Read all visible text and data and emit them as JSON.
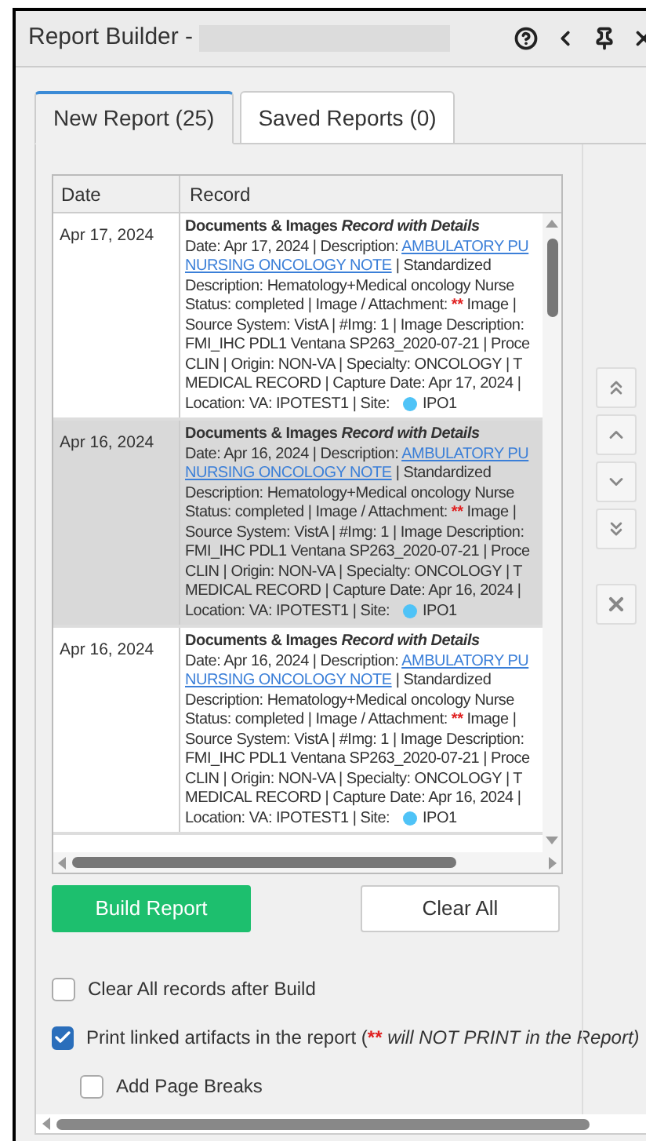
{
  "window": {
    "title": "Report Builder -"
  },
  "tabs": [
    {
      "label": "New Report (25)",
      "selected": true
    },
    {
      "label": "Saved Reports (0)",
      "selected": false
    }
  ],
  "table": {
    "columns": [
      "Date",
      "Record"
    ],
    "rows": [
      {
        "date": "Apr 17, 2024",
        "selected": false,
        "title": "Documents & Images *Record with Details*",
        "lines": [
          [
            {
              "kind": "text",
              "text": "Date: Apr 17, 2024 | Description: "
            },
            {
              "kind": "link",
              "text": "AMBULATORY PU"
            }
          ],
          [
            {
              "kind": "link",
              "text": "NURSING ONCOLOGY NOTE"
            },
            {
              "kind": "text",
              "text": " | Standardized"
            }
          ],
          [
            {
              "kind": "text",
              "text": "Description: Hematology+Medical oncology Nurse"
            }
          ],
          [
            {
              "kind": "text",
              "text": "Status: completed | Image / Attachment: "
            },
            {
              "kind": "marker",
              "text": "**"
            },
            {
              "kind": "text",
              "text": " Image |"
            }
          ],
          [
            {
              "kind": "text",
              "text": "Source System: VistA | #Img: 1 | Image Description:"
            }
          ],
          [
            {
              "kind": "text",
              "text": "FMI_IHC PDL1 Ventana SP263_2020-07-21 | Proce"
            }
          ],
          [
            {
              "kind": "text",
              "text": "CLIN | Origin: NON-VA | Specialty: ONCOLOGY | T"
            }
          ],
          [
            {
              "kind": "text",
              "text": "MEDICAL RECORD | Capture Date: Apr 17, 2024 |"
            }
          ],
          [
            {
              "kind": "text",
              "text": "Location: VA: IPOTEST1 | Site:"
            },
            {
              "kind": "dot"
            },
            {
              "kind": "text",
              "text": "IPO1"
            }
          ]
        ]
      },
      {
        "date": "Apr 16, 2024",
        "selected": true,
        "title": "Documents & Images *Record with Details*",
        "lines": [
          [
            {
              "kind": "text",
              "text": "Date: Apr 16, 2024 | Description: "
            },
            {
              "kind": "link",
              "text": "AMBULATORY PU"
            }
          ],
          [
            {
              "kind": "link",
              "text": "NURSING ONCOLOGY NOTE"
            },
            {
              "kind": "text",
              "text": " | Standardized"
            }
          ],
          [
            {
              "kind": "text",
              "text": "Description: Hematology+Medical oncology Nurse"
            }
          ],
          [
            {
              "kind": "text",
              "text": "Status: completed | Image / Attachment: "
            },
            {
              "kind": "marker",
              "text": "**"
            },
            {
              "kind": "text",
              "text": " Image |"
            }
          ],
          [
            {
              "kind": "text",
              "text": "Source System: VistA | #Img: 1 | Image Description:"
            }
          ],
          [
            {
              "kind": "text",
              "text": "FMI_IHC PDL1 Ventana SP263_2020-07-21 | Proce"
            }
          ],
          [
            {
              "kind": "text",
              "text": "CLIN | Origin: NON-VA | Specialty: ONCOLOGY | T"
            }
          ],
          [
            {
              "kind": "text",
              "text": "MEDICAL RECORD | Capture Date: Apr 16, 2024 |"
            }
          ],
          [
            {
              "kind": "text",
              "text": "Location: VA: IPOTEST1 | Site:"
            },
            {
              "kind": "dot"
            },
            {
              "kind": "text",
              "text": "IPO1"
            }
          ]
        ]
      },
      {
        "date": "Apr 16, 2024",
        "selected": false,
        "title": "Documents & Images *Record with Details*",
        "lines": [
          [
            {
              "kind": "text",
              "text": "Date: Apr 16, 2024 | Description: "
            },
            {
              "kind": "link",
              "text": "AMBULATORY PU"
            }
          ],
          [
            {
              "kind": "link",
              "text": "NURSING ONCOLOGY NOTE"
            },
            {
              "kind": "text",
              "text": " | Standardized"
            }
          ],
          [
            {
              "kind": "text",
              "text": "Description: Hematology+Medical oncology Nurse"
            }
          ],
          [
            {
              "kind": "text",
              "text": "Status: completed | Image / Attachment: "
            },
            {
              "kind": "marker",
              "text": "**"
            },
            {
              "kind": "text",
              "text": " Image |"
            }
          ],
          [
            {
              "kind": "text",
              "text": "Source System: VistA | #Img: 1 | Image Description:"
            }
          ],
          [
            {
              "kind": "text",
              "text": "FMI_IHC PDL1 Ventana SP263_2020-07-21 | Proce"
            }
          ],
          [
            {
              "kind": "text",
              "text": "CLIN | Origin: NON-VA | Specialty: ONCOLOGY | T"
            }
          ],
          [
            {
              "kind": "text",
              "text": "MEDICAL RECORD | Capture Date: Apr 16, 2024 |"
            }
          ],
          [
            {
              "kind": "text",
              "text": "Location: VA: IPOTEST1 | Site:"
            },
            {
              "kind": "dot"
            },
            {
              "kind": "text",
              "text": "IPO1"
            }
          ]
        ]
      }
    ]
  },
  "buttons": [
    {
      "label": "Build Report",
      "kind": "primary"
    },
    {
      "label": "Clear All",
      "kind": "secondary"
    }
  ],
  "options": [
    {
      "label": "Clear All records after Build",
      "checked": false
    },
    {
      "label": "Print linked artifacts in the report (",
      "marker": "**",
      "note": " will NOT PRINT in the Report)",
      "checked": true,
      "children": [
        {
          "label": "Add Page Breaks",
          "checked": false
        }
      ]
    }
  ]
}
